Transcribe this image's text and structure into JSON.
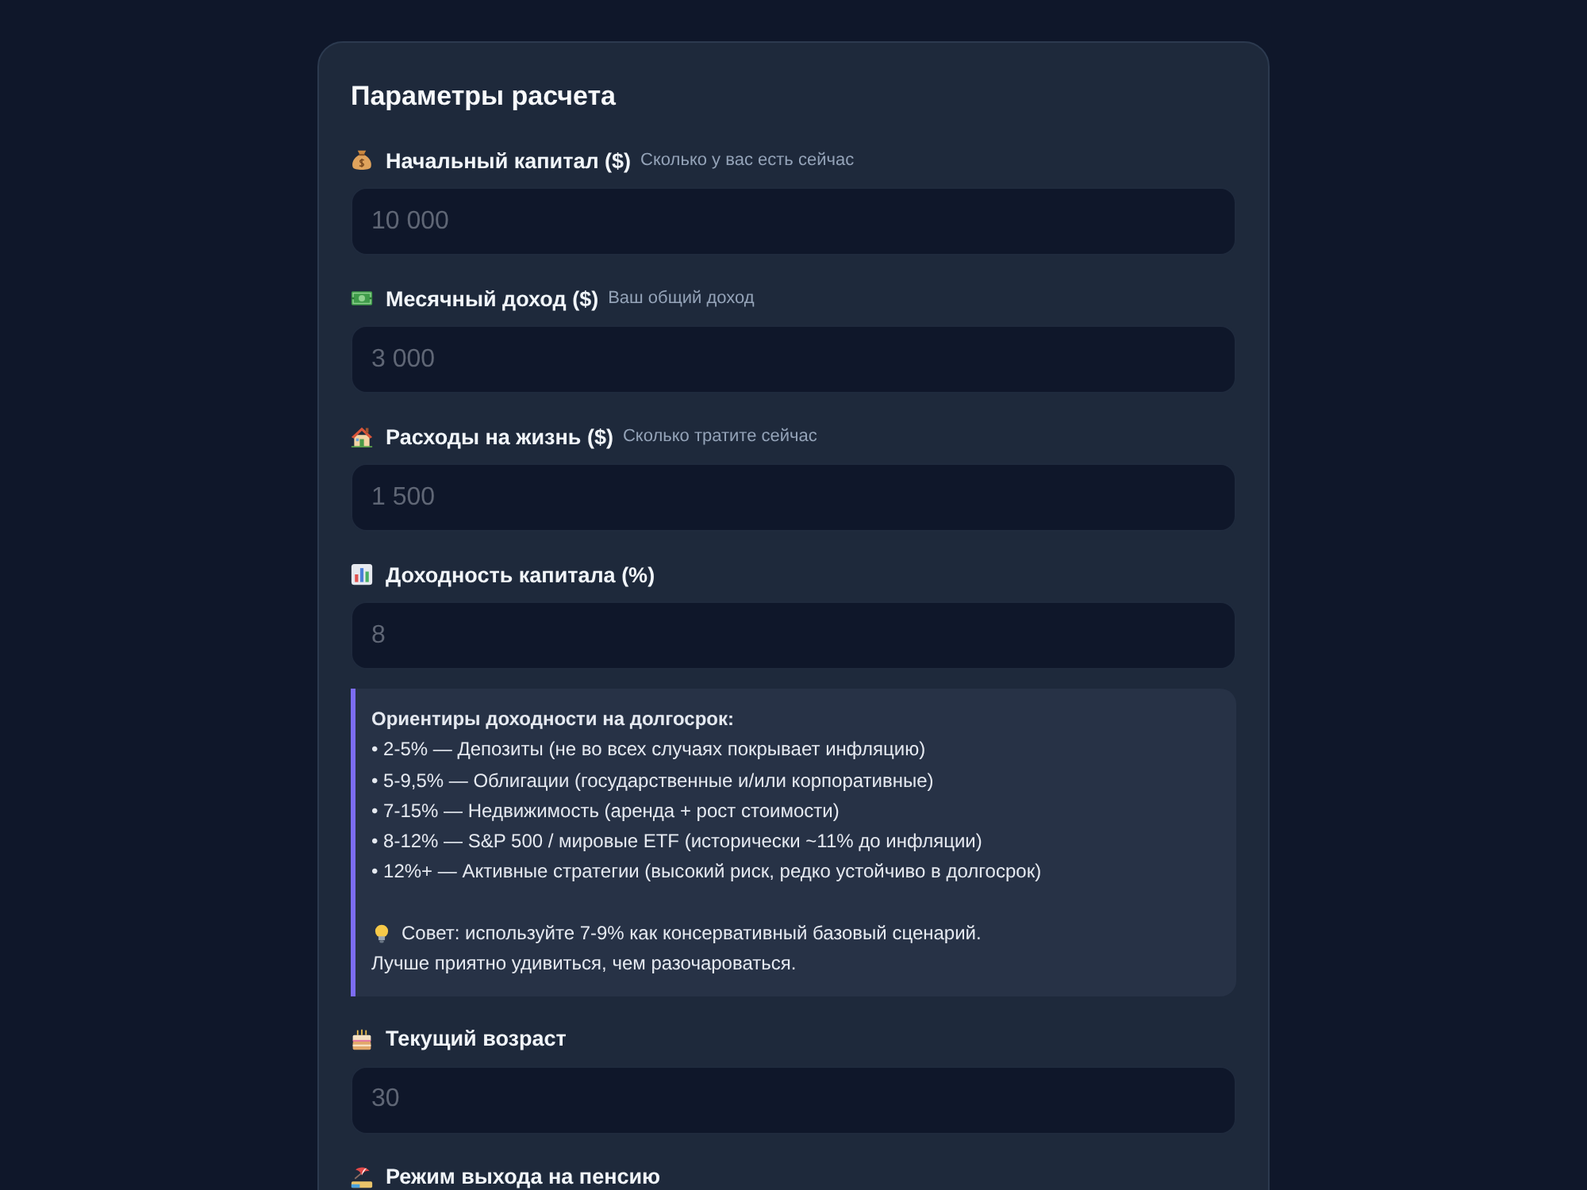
{
  "panel": {
    "title": "Параметры расчета",
    "items": [
      {
        "kind": "input",
        "label": "Начальный капитал ($)",
        "hint": "Сколько у вас есть сейчас",
        "placeholder": "10 000"
      },
      {
        "kind": "input",
        "label": "Месячный доход ($)",
        "hint": "Ваш общий доход",
        "placeholder": "3 000"
      },
      {
        "kind": "input",
        "label": "Расходы на жизнь ($)",
        "hint": "Сколько тратите сейчас",
        "placeholder": "1 500"
      },
      {
        "kind": "input",
        "label": "Доходность капитала (%)",
        "placeholder": "8"
      },
      {
        "kind": "note",
        "title": "Ориентиры доходности на долгосрок:",
        "lines": [
          "• 2-5% — Депозиты (не во всех случаях покрывает инфляцию)",
          "• 5-9,5% — Облигации (государственные и/или корпоративные)",
          "• 7-15% — Недвижимость (аренда + рост стоимости)",
          "• 8-12% — S&P 500 / мировые ETF (исторически ~11% до инфляции)",
          "• 12%+ — Активные стратегии (высокий риск, редко устойчиво в долгосрок)"
        ],
        "tip_lines": [
          "Совет: используйте 7-9% как консервативный базовый сценарий.",
          "Лучше приятно удивиться, чем разочароваться."
        ]
      },
      {
        "kind": "input",
        "label": "Текущий возраст",
        "placeholder": "30"
      },
      {
        "kind": "label",
        "label": "Режим выхода на пенсию"
      }
    ]
  }
}
